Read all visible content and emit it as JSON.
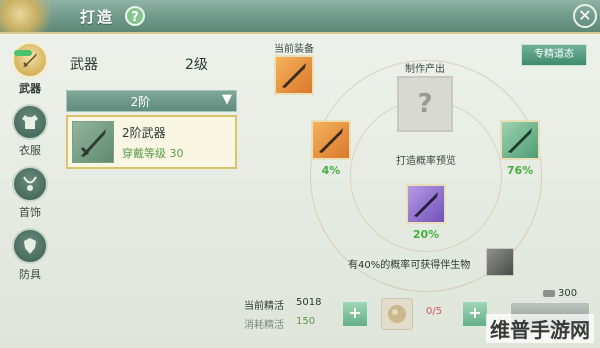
{
  "header": {
    "title": "打造",
    "help_label": "?"
  },
  "nav": [
    {
      "label": "武器",
      "icon": "sword-icon",
      "active": true
    },
    {
      "label": "衣服",
      "icon": "armor-icon",
      "active": false
    },
    {
      "label": "首饰",
      "icon": "necklace-icon",
      "active": false
    },
    {
      "label": "防具",
      "icon": "shield-icon",
      "active": false
    }
  ],
  "list": {
    "category": "武器",
    "level": "2级",
    "tier": "2阶",
    "item": {
      "name": "2阶武器",
      "requirement": "穿戴等级 30"
    }
  },
  "craft": {
    "current_equip_label": "当前装备",
    "output_label": "制作产出",
    "output_unknown": "?",
    "exclusive_button": "专精道态",
    "preview_label": "打造概率预览",
    "outcomes": [
      {
        "pct": "4%",
        "quality": "orange"
      },
      {
        "pct": "76%",
        "quality": "green"
      },
      {
        "pct": "20%",
        "quality": "purple"
      }
    ],
    "companion_text": "有40%的概率可获得伴生物"
  },
  "bottom": {
    "current_label": "当前精活",
    "current_value": "5018",
    "cost_label": "消耗精活",
    "cost_value": "150",
    "material_count": "0/5",
    "coin": "300"
  },
  "watermark": "维普手游网",
  "colors": {
    "header": "#6f998a",
    "accent_green": "#44b03f",
    "cost_green": "#5a9a48"
  }
}
